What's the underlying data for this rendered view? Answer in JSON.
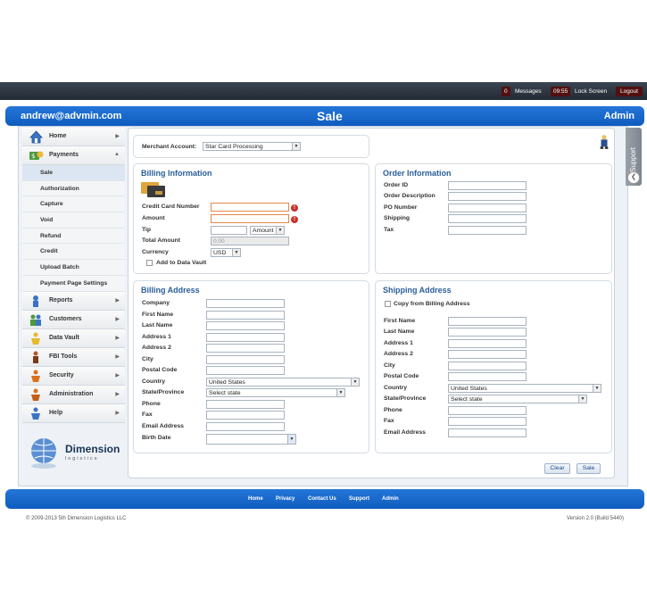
{
  "topbar": {
    "message_count": "0",
    "messages_label": "Messages",
    "time": "09:55",
    "lock_label": "Lock Screen",
    "logout_label": "Logout"
  },
  "header": {
    "user": "andrew@advmin.com",
    "title": "Sale",
    "role": "Admin"
  },
  "sidebar": {
    "items": [
      {
        "label": "Home",
        "icon": "home-icon"
      },
      {
        "label": "Payments",
        "icon": "payments-icon"
      },
      {
        "label": "Reports",
        "icon": "reports-icon"
      },
      {
        "label": "Customers",
        "icon": "customers-icon"
      },
      {
        "label": "Data Vault",
        "icon": "data-vault-icon"
      },
      {
        "label": "FBI Tools",
        "icon": "fbi-tools-icon"
      },
      {
        "label": "Security",
        "icon": "security-icon"
      },
      {
        "label": "Administration",
        "icon": "administration-icon"
      },
      {
        "label": "Help",
        "icon": "help-icon"
      }
    ],
    "payments_sub": [
      "Sale",
      "Authorization",
      "Capture",
      "Void",
      "Refund",
      "Credit",
      "Upload Batch",
      "Payment Page Settings"
    ],
    "logo_name": "Dimension",
    "logo_sub": "logistics"
  },
  "merchant": {
    "label": "Merchant Account:",
    "value": "Star Card Processing"
  },
  "billing_info": {
    "title": "Billing Information",
    "card_number_label": "Credit Card Number",
    "amount_label": "Amount",
    "tip_label": "Tip",
    "tip_type": "Amount",
    "total_label": "Total Amount",
    "total_value": "0.00",
    "currency_label": "Currency",
    "currency_value": "USD",
    "vault_label": "Add to Data Vault"
  },
  "order_info": {
    "title": "Order Information",
    "fields": [
      "Order ID",
      "Order Description",
      "PO Number",
      "Shipping",
      "Tax"
    ]
  },
  "billing_address": {
    "title": "Billing Address",
    "fields": [
      "Company",
      "First Name",
      "Last Name",
      "Address 1",
      "Address 2",
      "City",
      "Postal Code"
    ],
    "country_label": "Country",
    "country_value": "United States",
    "state_label": "State/Province",
    "state_value": "Select state",
    "phone_label": "Phone",
    "fax_label": "Fax",
    "email_label": "Email Address",
    "birth_label": "Birth Date"
  },
  "shipping_address": {
    "title": "Shipping Address",
    "copy_label": "Copy from Billing Address",
    "fields": [
      "First Name",
      "Last Name",
      "Address 1",
      "Address 2",
      "City",
      "Postal Code"
    ],
    "country_label": "Country",
    "country_value": "United States",
    "state_label": "State/Province",
    "state_value": "Select state",
    "phone_label": "Phone",
    "fax_label": "Fax",
    "email_label": "Email Address"
  },
  "actions": {
    "clear_label": "Clear",
    "sale_label": "Sale"
  },
  "support": {
    "label": "Support"
  },
  "footer": {
    "links": [
      "Home",
      "Privacy",
      "Contact Us",
      "Support",
      "Admin"
    ],
    "copyright": "© 2009-2013 5th Dimension Logistics LLC",
    "version": "Version 2.0 (Build 5440)"
  }
}
